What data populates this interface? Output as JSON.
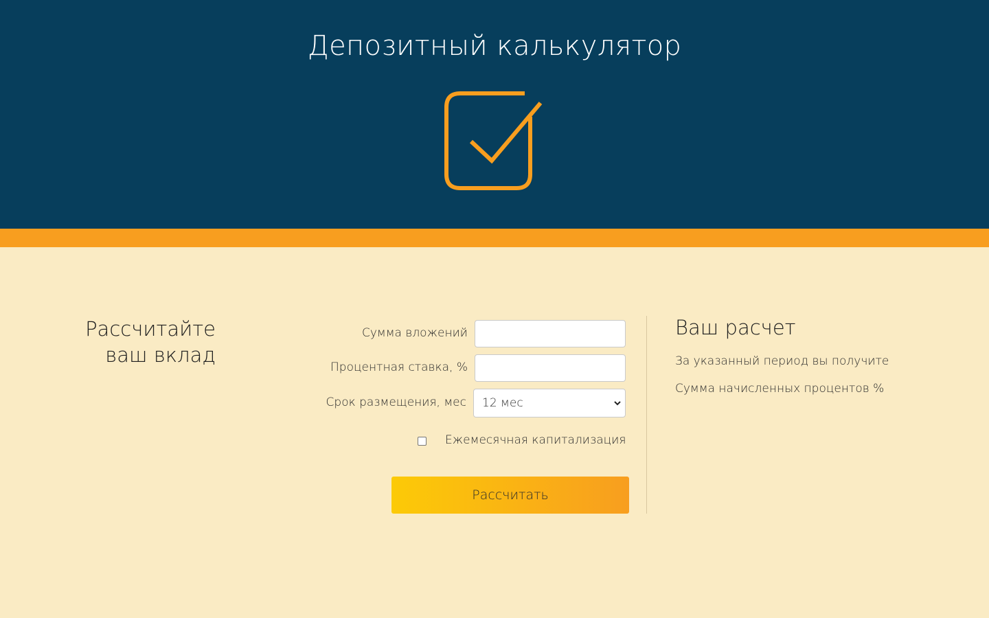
{
  "header": {
    "title": "Депозитный калькулятор",
    "icon": "checkbox-check-icon",
    "bg_color": "#073e5c",
    "accent_color": "#f89e1f"
  },
  "intro": {
    "title_line1": "Рассчитайте",
    "title_line2": "ваш вклад"
  },
  "form": {
    "amount_label": "Сумма вложений",
    "amount_value": "",
    "rate_label": "Процентная ставка, %",
    "rate_value": "",
    "term_label": "Срок размещения, мес",
    "term_selected": "12 мес",
    "capitalization_label": "Ежемесячная капитализация",
    "capitalization_checked": false,
    "submit_label": "Рассчитать"
  },
  "result": {
    "title": "Ваш расчет",
    "line1": "За указанный период вы получите",
    "line2": "Сумма начисленных процентов %"
  }
}
